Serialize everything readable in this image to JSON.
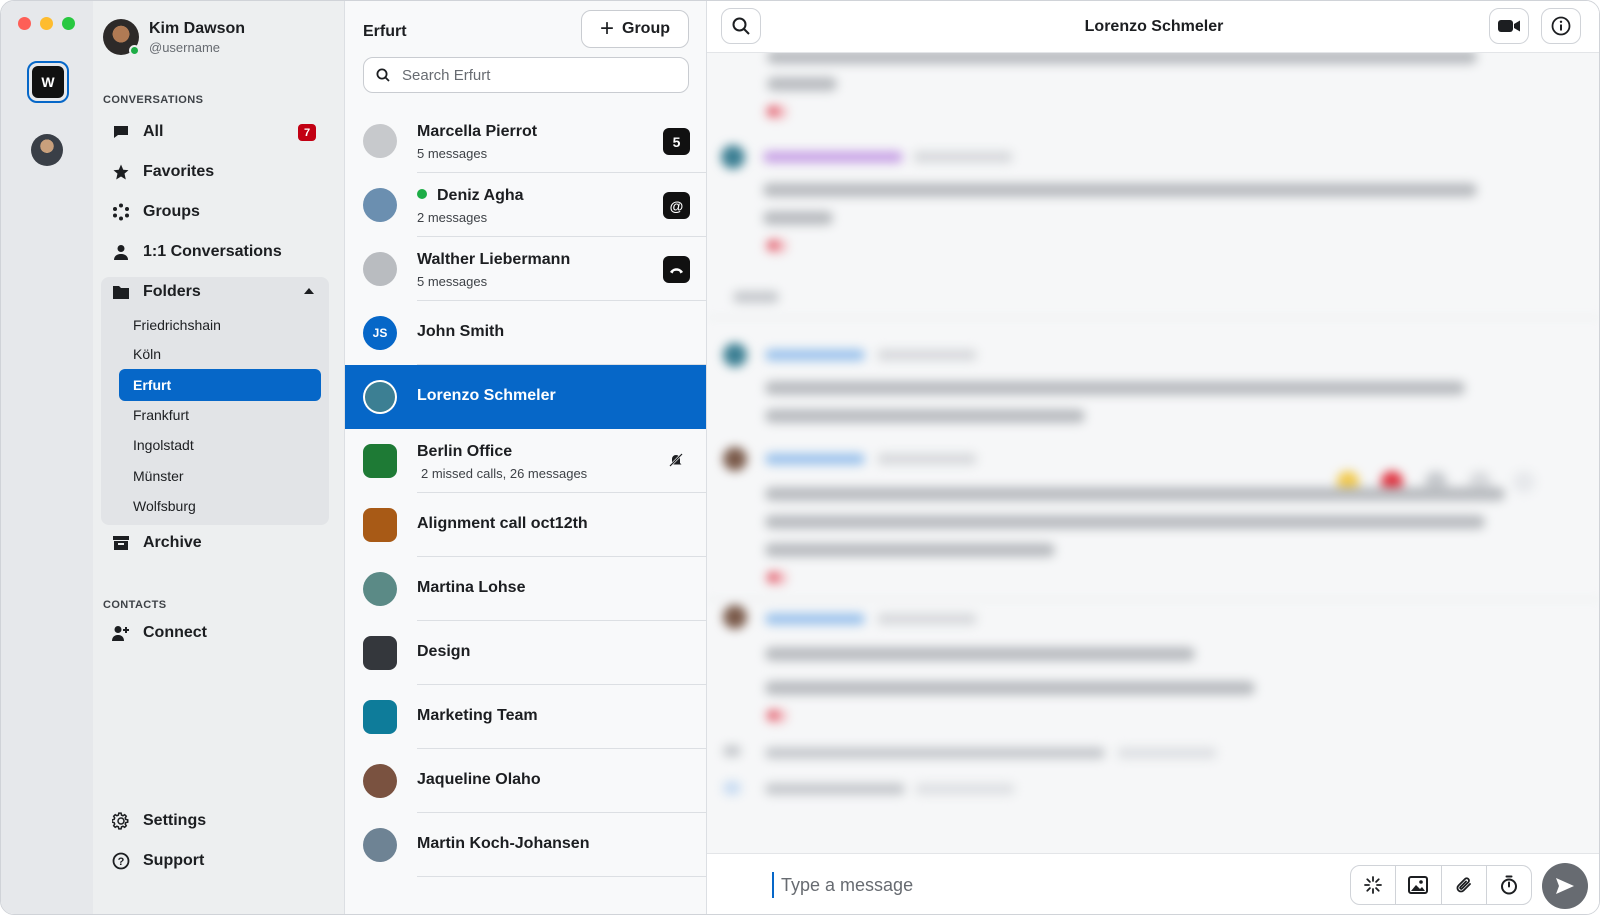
{
  "window": {
    "controls": [
      "close",
      "minimize",
      "maximize"
    ]
  },
  "accounts": {
    "items": [
      {
        "name": "wire-account",
        "glyph": "W",
        "active": true
      },
      {
        "name": "user-account",
        "active": false
      }
    ]
  },
  "sidebar": {
    "user": {
      "name": "Kim Dawson",
      "handle": "@username",
      "status": "online"
    },
    "conversations_label": "CONVERSATIONS",
    "nav": [
      {
        "label": "All",
        "icon": "chat-icon",
        "badge": "7"
      },
      {
        "label": "Favorites",
        "icon": "star-icon"
      },
      {
        "label": "Groups",
        "icon": "groups-icon"
      },
      {
        "label": "1:1 Conversations",
        "icon": "person-icon"
      },
      {
        "label": "Folders",
        "icon": "folder-icon",
        "expanded": true
      }
    ],
    "folders": [
      {
        "label": "Friedrichshain",
        "active": false
      },
      {
        "label": "Köln",
        "active": false
      },
      {
        "label": "Erfurt",
        "active": true
      },
      {
        "label": "Frankfurt",
        "active": false
      },
      {
        "label": "Ingolstadt",
        "active": false
      },
      {
        "label": "Münster",
        "active": false
      },
      {
        "label": "Wolfsburg",
        "active": false
      }
    ],
    "archive": {
      "label": "Archive",
      "icon": "archive-icon"
    },
    "contacts_label": "CONTACTS",
    "connect": {
      "label": "Connect",
      "icon": "add-person-icon"
    },
    "settings": {
      "label": "Settings",
      "icon": "gear-icon"
    },
    "support": {
      "label": "Support",
      "icon": "help-icon"
    }
  },
  "list": {
    "title": "Erfurt",
    "group_button": "Group",
    "search_placeholder": "Search Erfurt",
    "items": [
      {
        "name": "Marcella Pierrot",
        "sub": "5 messages",
        "status": "5",
        "avatar_color": "#c7c9cc",
        "shape": "round"
      },
      {
        "name": "Deniz Agha",
        "sub": "2 messages",
        "status": "@",
        "online": true,
        "avatar_color": "#6b8fb0",
        "shape": "round"
      },
      {
        "name": "Walther Liebermann",
        "sub": "5 messages",
        "status": "call",
        "avatar_color": "#b9bcc0",
        "shape": "round"
      },
      {
        "name": "John Smith",
        "initials": "JS",
        "avatar_color": "#0667c8",
        "shape": "round"
      },
      {
        "name": "Lorenzo Schmeler",
        "active": true,
        "avatar_color": "#3c7f93",
        "shape": "round"
      },
      {
        "name": "Berlin Office",
        "sub": "2 missed calls, 26 messages",
        "muted": true,
        "avatar_color": "#1e7a35",
        "shape": "square"
      },
      {
        "name": "Alignment call oct12th",
        "avatar_color": "#a85a16",
        "shape": "square"
      },
      {
        "name": "Martina Lohse",
        "avatar_color": "#5b8a86",
        "shape": "round"
      },
      {
        "name": "Design",
        "avatar_color": "#34373c",
        "shape": "square"
      },
      {
        "name": "Marketing Team",
        "avatar_color": "#0e7c9a",
        "shape": "square"
      },
      {
        "name": "Jaqueline Olaho",
        "avatar_color": "#7a5240",
        "shape": "round"
      },
      {
        "name": "Martin Koch-Johansen",
        "avatar_color": "#6e8394",
        "shape": "round"
      }
    ]
  },
  "conversation": {
    "title": "Lorenzo Schmeler",
    "composer_placeholder": "Type a message",
    "header_icons": [
      "search-icon",
      "video-call-icon",
      "info-icon"
    ],
    "composer_tools": [
      "sparkle-icon",
      "image-icon",
      "paperclip-icon",
      "timer-icon"
    ],
    "send_icon": "send-icon"
  }
}
